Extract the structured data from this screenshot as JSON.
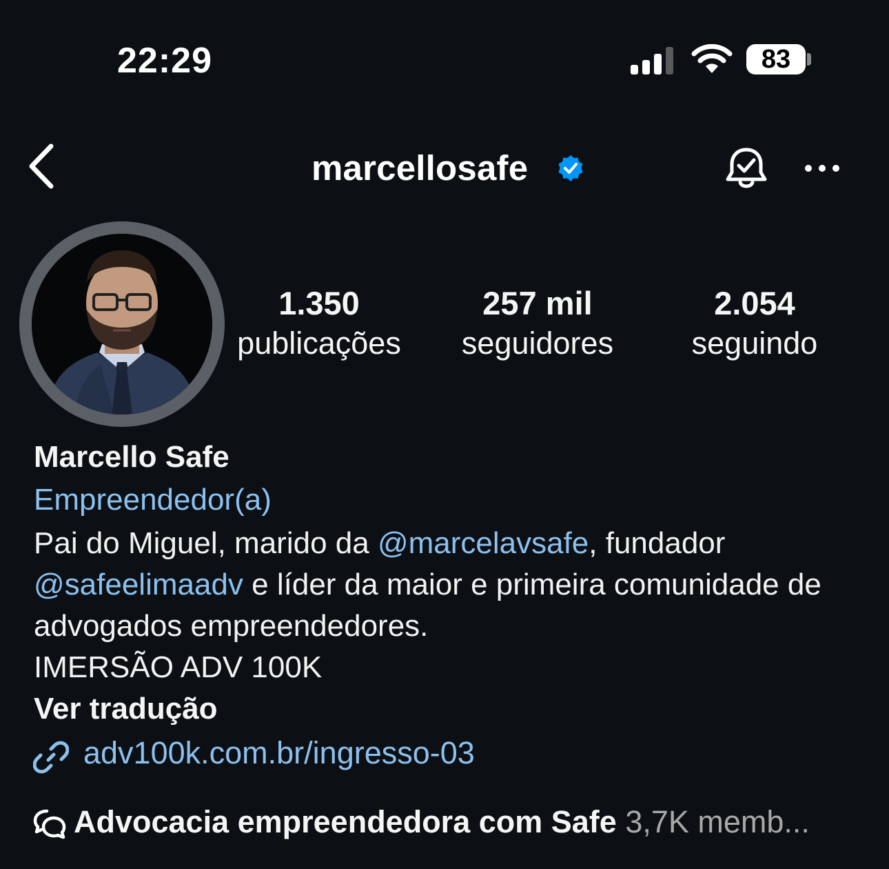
{
  "status_bar": {
    "time": "22:29",
    "battery_level": "83",
    "icons": [
      "cellular-signal-icon",
      "wifi-icon",
      "battery-icon"
    ]
  },
  "header": {
    "username": "marcellosafe",
    "verified": true,
    "icons": [
      "back-chevron-icon",
      "verified-badge-icon",
      "notification-bell-icon",
      "more-options-icon"
    ]
  },
  "profile": {
    "stats": [
      {
        "value": "1.350",
        "label": "publicações"
      },
      {
        "value": "257 mil",
        "label": "seguidores"
      },
      {
        "value": "2.054",
        "label": "seguindo"
      }
    ],
    "full_name": "Marcello Safe",
    "category": "Empreendedor(a)",
    "bio": {
      "part1": "Pai do Miguel, marido da ",
      "mention1": "@marcelavsafe",
      "part2": ", fundador",
      "mention2": "@safeelimaadv",
      "part3": " e líder da maior e primeira comunidade de advogados empreendedores.",
      "line4": "IMERSÃO ADV 100K"
    },
    "translate_label": "Ver tradução",
    "link": "adv100k.com.br/ingresso-03",
    "community": {
      "name": "Advocacia empreendedora com Safe",
      "members": "3,7K memb..."
    }
  },
  "colors": {
    "background": "#0c1014",
    "link_blue": "#8bc0ef",
    "verified_blue": "#0095f6",
    "muted_text": "#a8a8a8"
  }
}
